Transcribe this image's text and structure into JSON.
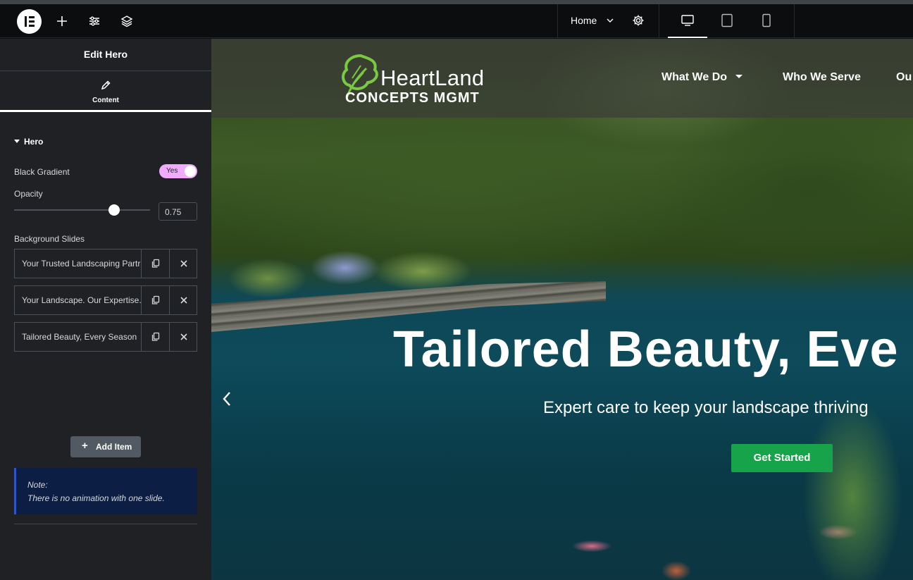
{
  "topbar": {
    "page_name": "Home",
    "icons": [
      "elementor-logo-icon",
      "plus-icon",
      "sliders-icon",
      "layers-icon",
      "chevron-down-icon",
      "gear-icon",
      "desktop-icon",
      "tablet-icon",
      "mobile-icon"
    ],
    "active_device": "desktop"
  },
  "panel": {
    "title": "Edit Hero",
    "tab_label": "Content",
    "section_title": "Hero",
    "black_gradient": {
      "label": "Black Gradient",
      "toggle_text": "Yes",
      "enabled": true
    },
    "opacity": {
      "label": "Opacity",
      "value": "0.75",
      "fraction": 0.75
    },
    "slides_label": "Background Slides",
    "slides": [
      {
        "title": "Your Trusted Landscaping Partr"
      },
      {
        "title": "Your Landscape. Our Expertise."
      },
      {
        "title": "Tailored Beauty, Every Season"
      }
    ],
    "add_item_label": "Add Item",
    "note_heading": "Note:",
    "note_body": "There is no animation with one slide.",
    "collapse_glyph": "‹"
  },
  "site": {
    "logo_line1": "HeartLand",
    "logo_line2": "CONCEPTS  MGMT",
    "nav": [
      {
        "label": "What We Do",
        "dropdown": true
      },
      {
        "label": "Who We Serve",
        "dropdown": false
      },
      {
        "label": "Ou",
        "dropdown": false
      }
    ],
    "hero_title": "Tailored Beauty, Eve",
    "hero_subtitle": "Expert care to keep your landscape thriving",
    "cta_label": "Get Started",
    "prev_arrow_glyph": "‹"
  },
  "colors": {
    "toggle_on": "#f0abfc",
    "cta_green": "#16a34a",
    "note_bg": "#0c1e43",
    "note_border": "#2f55c5",
    "panel_bg": "#1f2124",
    "topbar_bg": "#0c0d0e"
  }
}
